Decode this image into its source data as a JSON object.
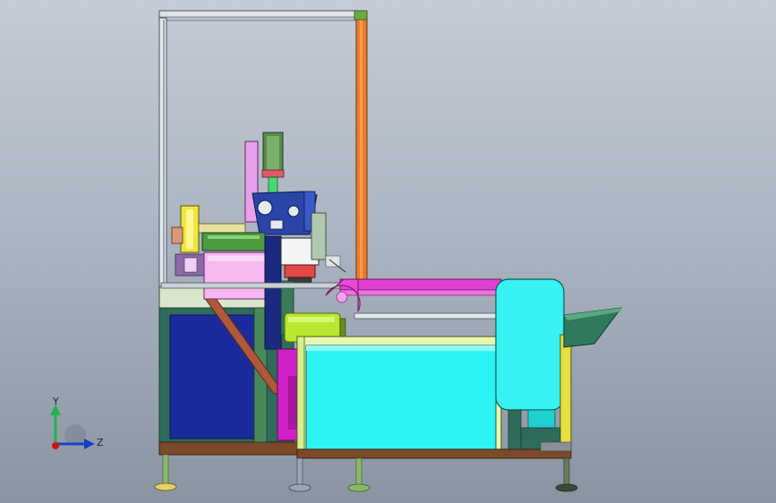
{
  "viewport": {
    "background_top": "#c4ccd6",
    "background_bottom": "#8a94a0"
  },
  "triad": {
    "y_label": "Y",
    "z_label": "Z",
    "y_color": "#22b14c",
    "z_color": "#1a3cc8",
    "x_color": "#d01010"
  },
  "model": {
    "type": "machine-assembly-side-view",
    "parts": [
      "aluminum-frame",
      "vertical-slide",
      "motor",
      "lift-block",
      "pink-cover",
      "conveyor",
      "pulley-guard",
      "cyan-hood",
      "lime-motor",
      "cyan-tank",
      "discharge-chute",
      "leveling-feet"
    ]
  }
}
